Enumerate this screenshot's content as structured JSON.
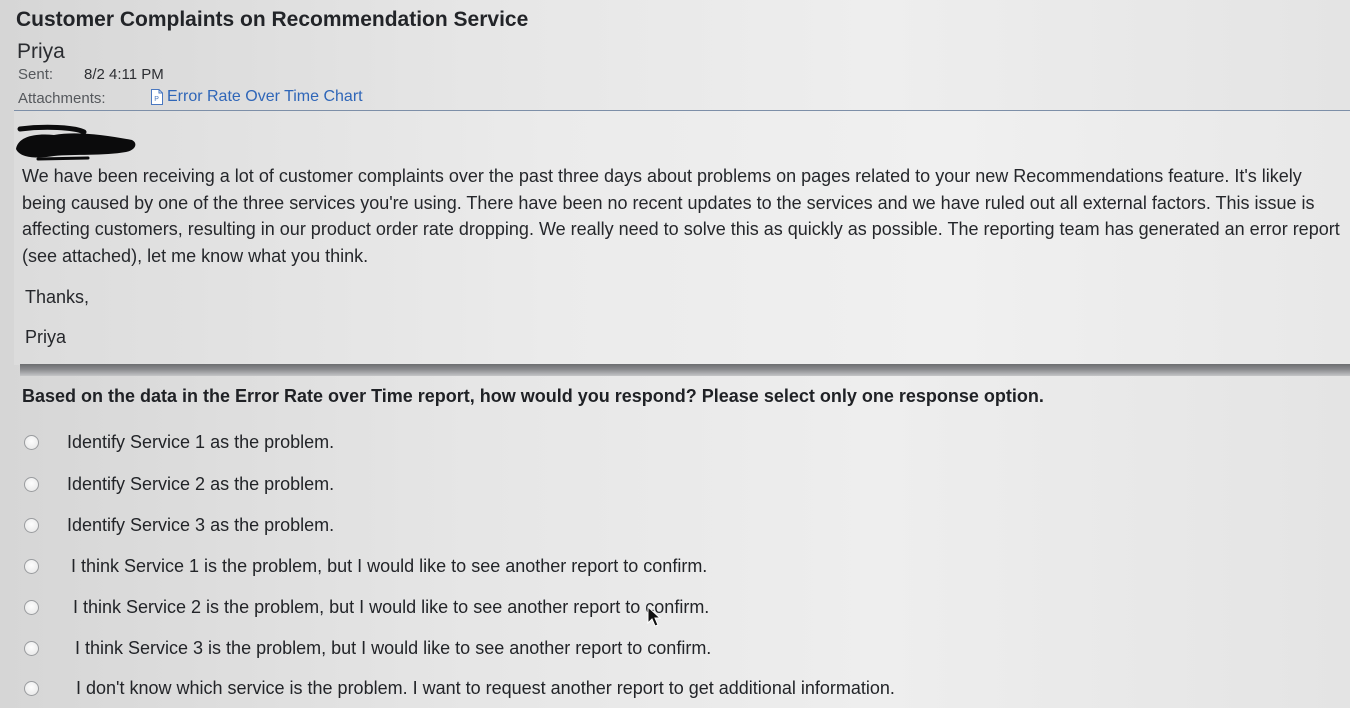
{
  "email": {
    "subject": "Customer Complaints on Recommendation Service",
    "sender": "Priya",
    "sent_label": "Sent:",
    "sent_value": "8/2 4:11 PM",
    "attachments_label": "Attachments:",
    "attachment_name": "Error Rate Over Time Chart",
    "body": "We have been receiving a lot of customer complaints over the past three days about problems on pages related to your new Recommendations feature. It's likely being caused by one of the three services you're using. There have been no recent updates to the services and we have ruled out all external factors. This issue is affecting customers, resulting in our product order rate dropping. We really need to solve this as quickly as possible. The reporting team has generated an error report (see attached), let me know what you think.",
    "closing": "Thanks,",
    "signature": "Priya"
  },
  "question": {
    "prompt": "Based on the data in the Error Rate over Time report, how would you respond? Please select only one response option.",
    "options": [
      {
        "label": "Identify Service 1 as the problem."
      },
      {
        "label": "Identify Service 2 as the problem."
      },
      {
        "label": "Identify Service 3 as the problem."
      },
      {
        "label": "I think Service 1 is the problem, but I would like to see another report to confirm."
      },
      {
        "label": "I think Service 2 is the problem, but I would like to see another report to confirm."
      },
      {
        "label": "I think Service 3 is the problem, but I would like to see another report to confirm."
      },
      {
        "label": "I don't know which service is the problem. I want to request another report to get additional information."
      }
    ]
  },
  "icons": {
    "attachment": "document-icon",
    "cursor": "mouse-pointer-icon"
  },
  "colors": {
    "link": "#2f66b8",
    "divider": "#7d8fa8"
  }
}
